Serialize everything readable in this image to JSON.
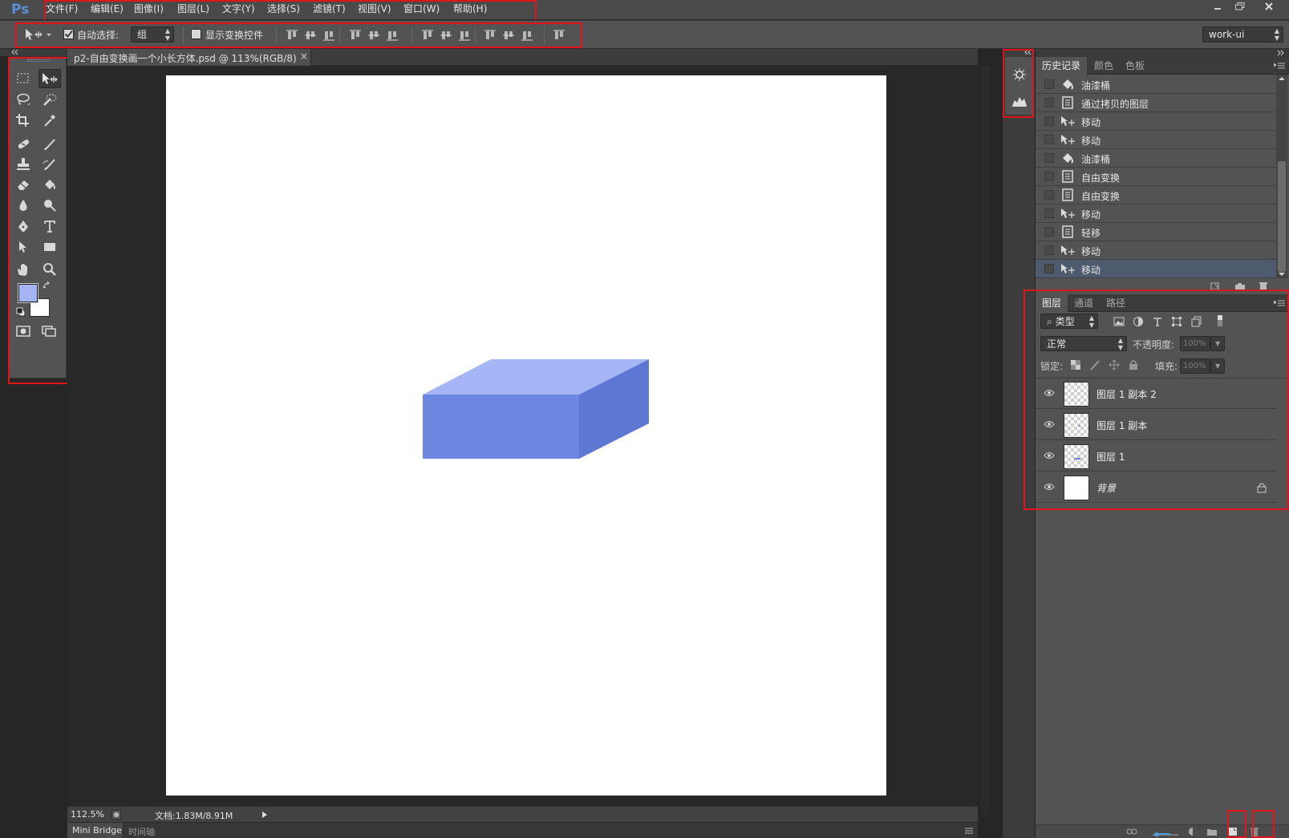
{
  "app": {
    "logo": "Ps",
    "menu": [
      "文件(F)",
      "编辑(E)",
      "图像(I)",
      "图层(L)",
      "文字(Y)",
      "选择(S)",
      "滤镜(T)",
      "视图(V)",
      "窗口(W)",
      "帮助(H)"
    ]
  },
  "options": {
    "auto_select_label": "自动选择:",
    "auto_select_checked": true,
    "auto_select_value": "组",
    "show_transform_label": "显示变换控件",
    "show_transform_checked": false,
    "workspace": "work-ui"
  },
  "document": {
    "tab_title": "p2-自由变换画一个小长方体.psd @ 113%(RGB/8)",
    "close_glyph": "×",
    "zoom": "112.5%",
    "doc_info": "文档:1.83M/8.91M",
    "foreground_color": "#a4b4f4",
    "background_color": "#ffffff",
    "shape_colors": {
      "top": "#a6b5f6",
      "front": "#6c87e0",
      "side": "#5d78d2"
    }
  },
  "bottom_tabs": [
    "Mini Bridge",
    "时间轴"
  ],
  "history": {
    "tabs": [
      "历史记录",
      "颜色",
      "色板"
    ],
    "items": [
      {
        "icon": "paint-bucket",
        "label": "油漆桶"
      },
      {
        "icon": "layer-doc",
        "label": "通过拷贝的图层"
      },
      {
        "icon": "move",
        "label": "移动"
      },
      {
        "icon": "move",
        "label": "移动"
      },
      {
        "icon": "paint-bucket",
        "label": "油漆桶"
      },
      {
        "icon": "layer-doc",
        "label": "自由变换"
      },
      {
        "icon": "layer-doc",
        "label": "自由变换"
      },
      {
        "icon": "move",
        "label": "移动"
      },
      {
        "icon": "layer-doc",
        "label": "轻移"
      },
      {
        "icon": "move",
        "label": "移动"
      },
      {
        "icon": "move",
        "label": "移动"
      }
    ],
    "selected_index": 10
  },
  "layers": {
    "tabs": [
      "图层",
      "通道",
      "路径"
    ],
    "filter_kind": "类型",
    "blend_mode": "正常",
    "opacity_label": "不透明度:",
    "opacity_value": "100%",
    "lock_label": "锁定:",
    "fill_label": "填充:",
    "fill_value": "100%",
    "items": [
      {
        "name": "图层 1 副本 2",
        "visible": true
      },
      {
        "name": "图层 1 副本",
        "visible": true
      },
      {
        "name": "图层 1",
        "visible": true
      },
      {
        "name": "背景",
        "visible": true,
        "locked": true
      }
    ]
  }
}
